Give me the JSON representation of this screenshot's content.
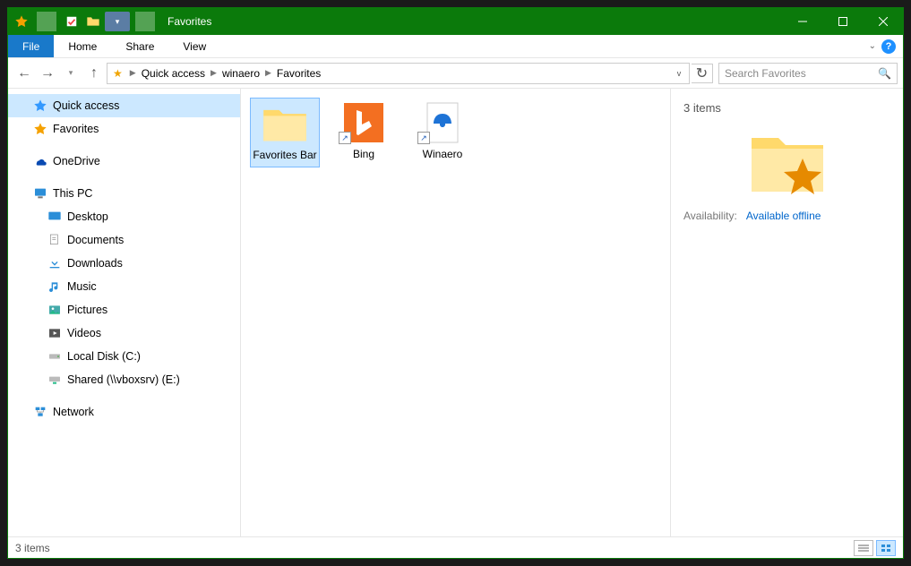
{
  "title": "Favorites",
  "ribbon": {
    "file": "File",
    "home": "Home",
    "share": "Share",
    "view": "View"
  },
  "breadcrumb": [
    "Quick access",
    "winaero",
    "Favorites"
  ],
  "search_placeholder": "Search Favorites",
  "nav": {
    "quick_access": "Quick access",
    "favorites": "Favorites",
    "onedrive": "OneDrive",
    "this_pc": "This PC",
    "desktop": "Desktop",
    "documents": "Documents",
    "downloads": "Downloads",
    "music": "Music",
    "pictures": "Pictures",
    "videos": "Videos",
    "local_disk": "Local Disk (C:)",
    "shared": "Shared (\\\\vboxsrv) (E:)",
    "network": "Network"
  },
  "items": {
    "favorites_bar": "Favorites Bar",
    "bing": "Bing",
    "winaero": "Winaero"
  },
  "details": {
    "count": "3 items",
    "availability_label": "Availability:",
    "availability_value": "Available offline"
  },
  "status": {
    "items": "3 items"
  }
}
